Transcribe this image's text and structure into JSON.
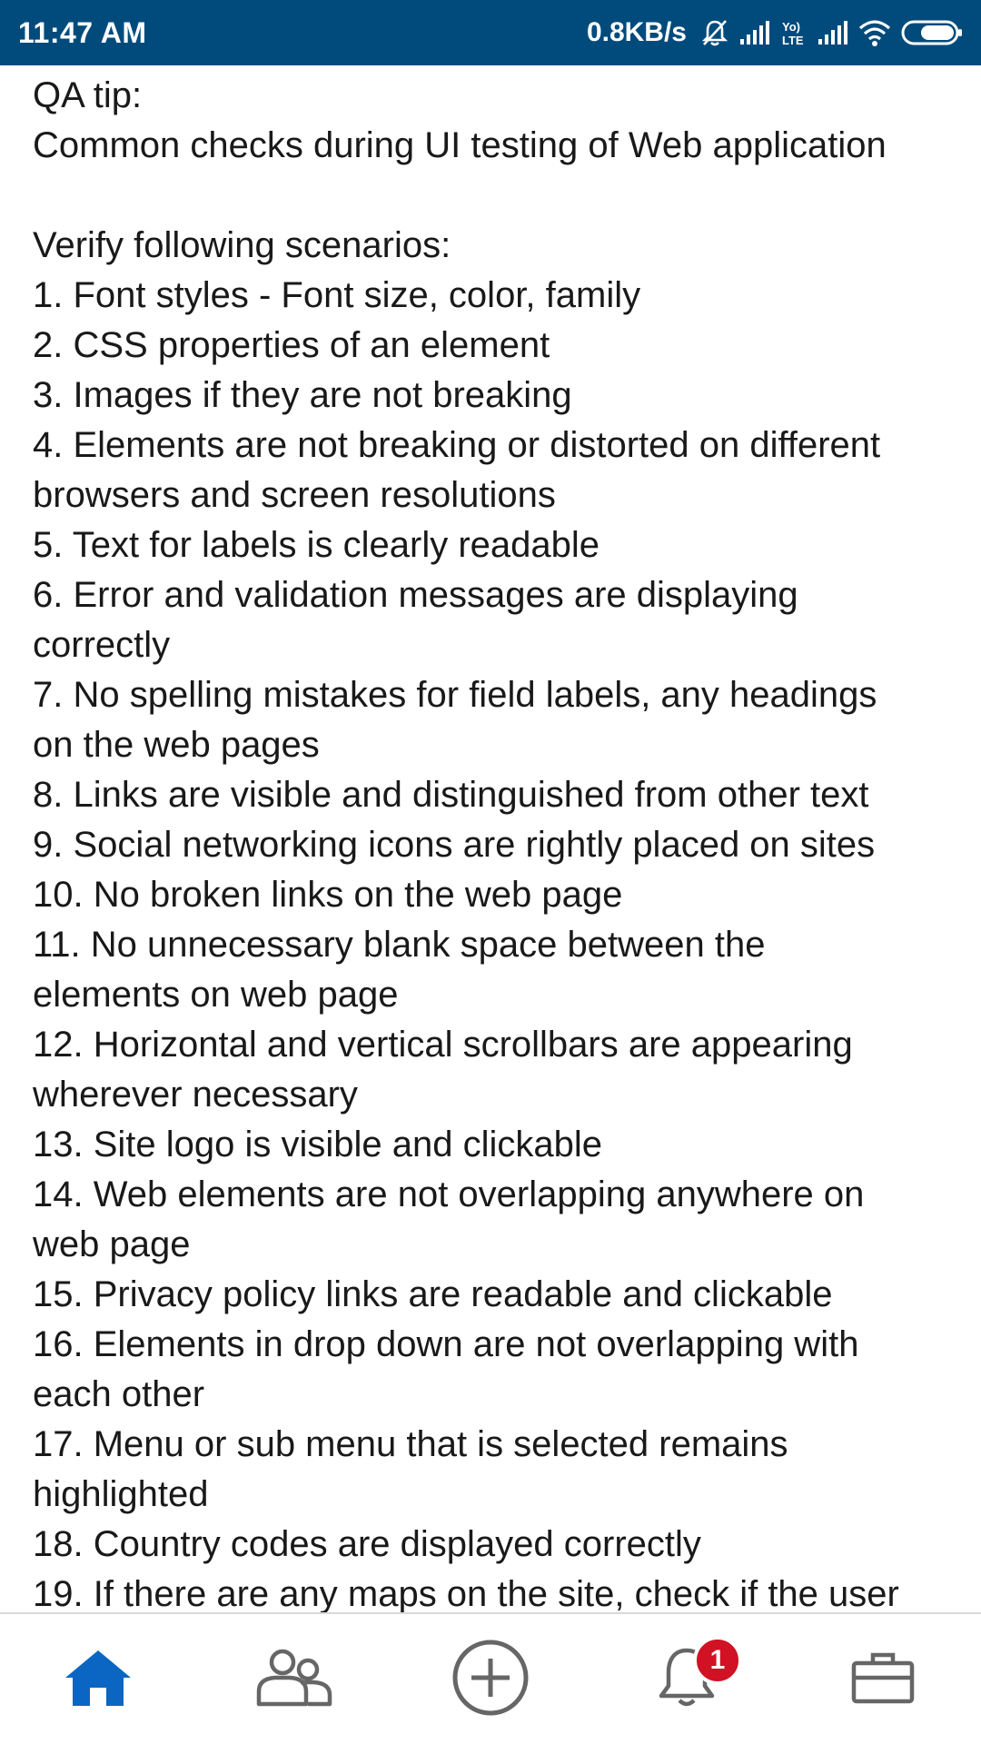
{
  "status_bar": {
    "time": "11:47 AM",
    "network_speed": "0.8KB/s",
    "icons": [
      "notification-muted-icon",
      "signal-1-icon",
      "volte-icon",
      "signal-2-icon",
      "wifi-icon",
      "battery-icon"
    ],
    "background_color": "#004b7c"
  },
  "post": {
    "text": "QA tip:\nCommon checks during UI testing of Web application\n\nVerify following scenarios:\n1. Font styles - Font size, color, family\n2. CSS properties of an element\n3. Images if they are not breaking\n4. Elements are not breaking or distorted on different\nbrowsers and screen resolutions\n5. Text for labels is clearly readable\n6. Error and validation messages are displaying\ncorrectly\n7. No spelling mistakes for field labels, any headings\non the web pages\n8. Links are visible and distinguished from other text\n9. Social networking icons are rightly placed on sites\n10. No broken links on the web page\n11. No unnecessary blank space between the\nelements on web page\n12. Horizontal and vertical scrollbars are appearing\nwherever necessary\n13. Site logo is visible and clickable\n14. Web elements are not overlapping anywhere on\nweb page\n15. Privacy policy links are readable and clickable\n16. Elements in drop down are not overlapping with\neach other\n17. Menu or sub menu that is selected remains\nhighlighted\n18. Country codes are displayed correctly\n19. If there are any maps on the site, check if the user"
  },
  "bottom_nav": {
    "items": [
      {
        "icon": "home-icon",
        "active": true
      },
      {
        "icon": "my-network-icon",
        "active": false
      },
      {
        "icon": "post-icon",
        "active": false
      },
      {
        "icon": "notifications-icon",
        "active": false,
        "badge": "1"
      },
      {
        "icon": "jobs-icon",
        "active": false
      }
    ],
    "active_color": "#0a66c2",
    "inactive_color": "#666666",
    "badge_color": "#d11124"
  }
}
